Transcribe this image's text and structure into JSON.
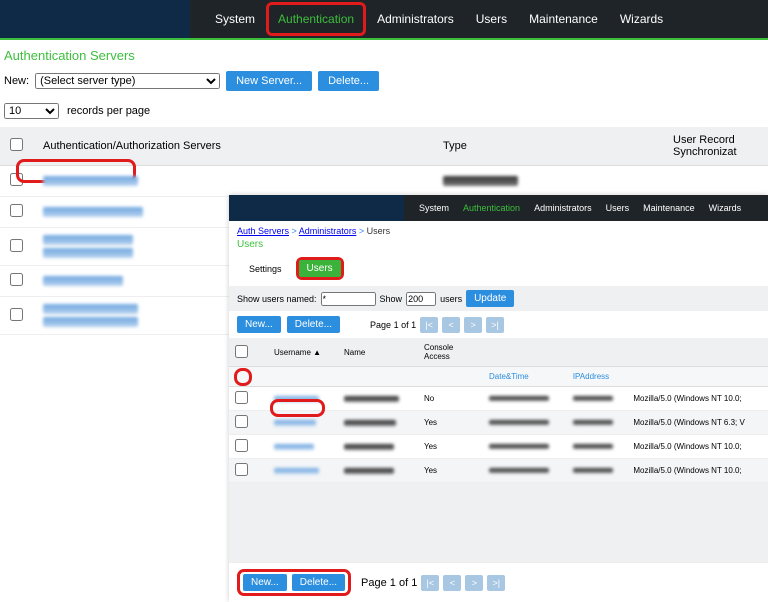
{
  "top_nav": {
    "items": [
      "System",
      "Authentication",
      "Administrators",
      "Users",
      "Maintenance",
      "Wizards"
    ],
    "active_index": 1
  },
  "page_title": "Authentication Servers",
  "new_server": {
    "label": "New:",
    "placeholder": "(Select server type)",
    "new_button": "New Server...",
    "delete_button": "Delete..."
  },
  "records": {
    "count": "10",
    "label": "records per page"
  },
  "main_table": {
    "headers": {
      "name": "Authentication/Authorization Servers",
      "type": "Type",
      "sync": "User Record Synchronizat"
    }
  },
  "inner": {
    "nav": {
      "items": [
        "System",
        "Authentication",
        "Administrators",
        "Users",
        "Maintenance",
        "Wizards"
      ],
      "active_index": 1
    },
    "breadcrumb": {
      "a": "Auth Servers",
      "b": "Administrators",
      "c": "Users"
    },
    "title": "Users",
    "tabs": {
      "settings": "Settings",
      "users": "Users"
    },
    "filter": {
      "show_label": "Show users named:",
      "named_value": "*",
      "show_label2": "Show",
      "count_value": "200",
      "users_label": "users",
      "update": "Update"
    },
    "actions": {
      "new": "New...",
      "delete": "Delete..."
    },
    "pager": {
      "label": "Page 1 of 1"
    },
    "table": {
      "headers": {
        "username": "Username",
        "username_sort": "▲",
        "name": "Name",
        "console": "Console Access",
        "datetime": "Date&Time",
        "ip": "IPAddress"
      },
      "rows": [
        {
          "console": "No",
          "ua": "Mozilla/5.0 (Windows NT 10.0;"
        },
        {
          "console": "Yes",
          "ua": "Mozilla/5.0 (Windows NT 6.3; V"
        },
        {
          "console": "Yes",
          "ua": "Mozilla/5.0 (Windows NT 10.0;"
        },
        {
          "console": "Yes",
          "ua": "Mozilla/5.0 (Windows NT 10.0;"
        }
      ]
    }
  }
}
